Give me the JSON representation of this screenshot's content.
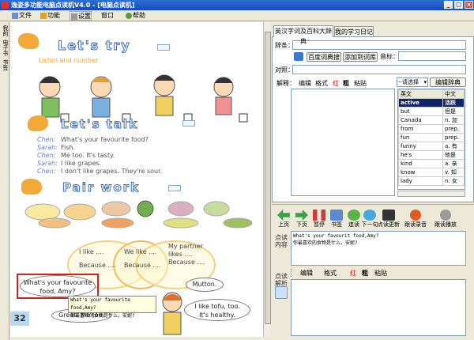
{
  "window": {
    "title": "逸姿多功能电脑点读机V4.0 - [电脑点读机]"
  },
  "menubar": {
    "items": [
      "文件",
      "功能",
      "设置",
      "窗口",
      "帮助"
    ]
  },
  "left_strip": {
    "items": [
      "我的",
      "电子书",
      "书签"
    ]
  },
  "book": {
    "page_number": "32",
    "lets_try": "Let's try",
    "listen_and_number": "Listen and number",
    "lets_talk": "Let's talk",
    "pair_work": "Pair work",
    "dialog": [
      {
        "speaker": "Chen:",
        "text": "What's your favourite food?"
      },
      {
        "speaker": "Sarah:",
        "text": "Fish."
      },
      {
        "speaker": "Chen:",
        "text": "Me too. It's tasty."
      },
      {
        "speaker": "Sarah:",
        "text": "I like grapes."
      },
      {
        "speaker": "Chen:",
        "text": "I don't like grapes. They're sour."
      }
    ],
    "venn": {
      "left1": "I like ....",
      "left2": "Because ....",
      "mid1": "We like ....",
      "mid2": "Because ....",
      "right1": "My partner",
      "right2": "likes ....",
      "right3": "Because ...."
    },
    "bubbles": {
      "q1": "What's your favourite",
      "q2": "food, Amy?",
      "mutton": "Mutton.",
      "tofu1": "I like tofu, too.",
      "tofu2": "It's healthy.",
      "great": "Great! Me too."
    },
    "tooltip": {
      "en": "What's your favourite food,Amy?",
      "zh": "你最喜欢的食物是什么，安妮?"
    }
  },
  "tabs": [
    "英汉字词及百科大辞典",
    "我的学习日记"
  ],
  "dict": {
    "word_label": "辞条：",
    "dict_button": "百度词典搜",
    "add_vocab_button": "添加到词库",
    "phonetic_label": "音标：",
    "translation_label": "对照：",
    "explain_label": "解释：",
    "edit_toolbar": [
      "编辑",
      "格式",
      "红",
      "粗",
      "粘贴"
    ],
    "select_placeholder": "--请选择",
    "edit_dict_button": "编辑辞典",
    "wordlist_headers": [
      "英文",
      "中文"
    ],
    "wordlist": [
      {
        "en": "active",
        "zh": "活跃",
        "selected": true
      },
      {
        "en": "but",
        "zh": "但是"
      },
      {
        "en": "Canada",
        "zh": "n. 加"
      },
      {
        "en": "from",
        "zh": "prep."
      },
      {
        "en": "fun",
        "zh": "prep."
      },
      {
        "en": "funny",
        "zh": "a. 有"
      },
      {
        "en": "he's",
        "zh": "他是"
      },
      {
        "en": "kind",
        "zh": "a. 亲"
      },
      {
        "en": "know",
        "zh": "v. 知"
      },
      {
        "en": "lady",
        "zh": "n. 女"
      }
    ]
  },
  "player": {
    "buttons": [
      "上页",
      "下页",
      "暂停",
      "书签",
      "连读",
      "下一句",
      "点读更新",
      "跟读录音",
      "跟读播放"
    ],
    "content_label": "点读内容",
    "content_en": "What's your favourit food,Amy?",
    "content_zh": "你最喜欢的食物是什么，安妮?",
    "parse_label": "点读解析",
    "parse_toolbar": [
      "编辑",
      "格式",
      "红",
      "粗",
      "粘贴"
    ]
  },
  "colors": {
    "titlebar": "#1f58c8",
    "selected_row": "#10246a",
    "red_text": "#d00000",
    "highlight_box": "#d02020"
  }
}
